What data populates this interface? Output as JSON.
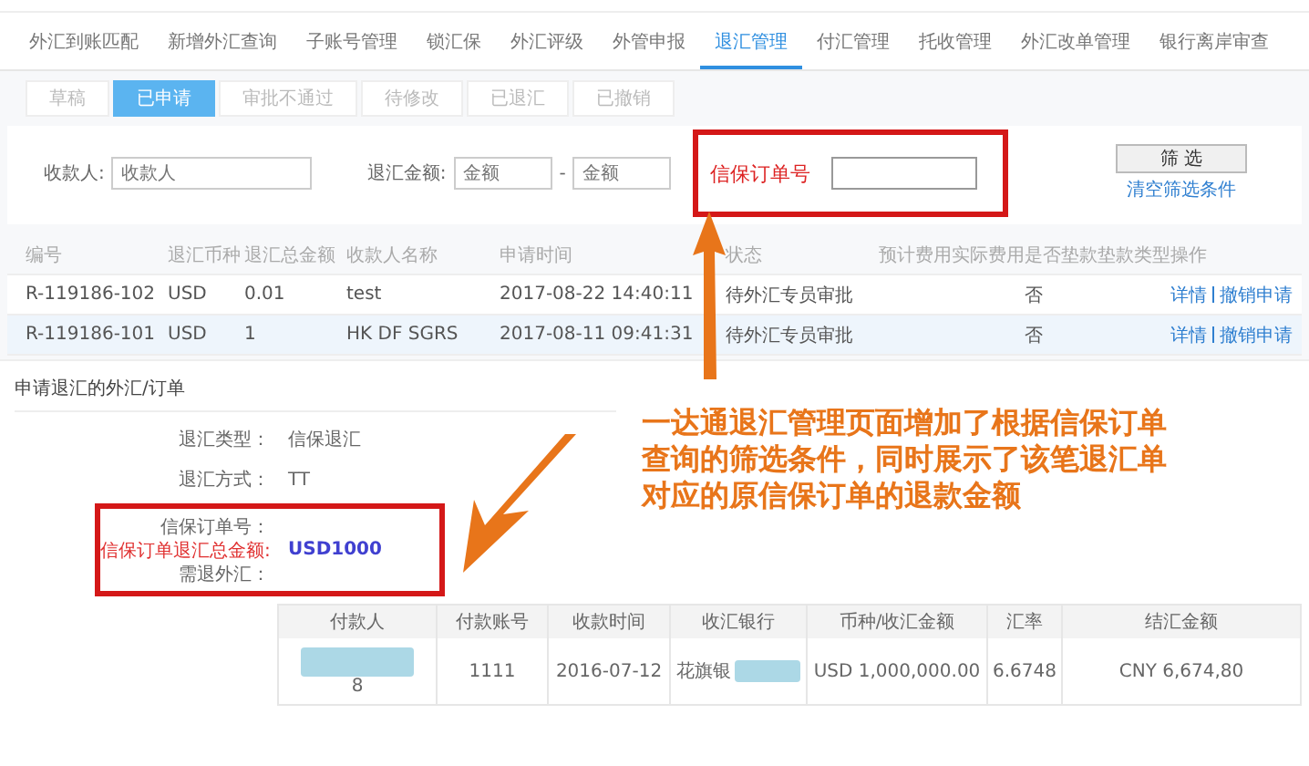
{
  "nav_tabs": [
    {
      "label": "外汇到账匹配",
      "selected": false
    },
    {
      "label": "新增外汇查询",
      "selected": false
    },
    {
      "label": "子账号管理",
      "selected": false
    },
    {
      "label": "锁汇保",
      "selected": false
    },
    {
      "label": "外汇评级",
      "selected": false
    },
    {
      "label": "外管申报",
      "selected": false
    },
    {
      "label": "退汇管理",
      "selected": true
    },
    {
      "label": "付汇管理",
      "selected": false
    },
    {
      "label": "托收管理",
      "selected": false
    },
    {
      "label": "外汇改单管理",
      "selected": false
    },
    {
      "label": "银行离岸审查",
      "selected": false
    }
  ],
  "status_tabs": [
    {
      "label": "草稿",
      "selected": false
    },
    {
      "label": "已申请",
      "selected": true
    },
    {
      "label": "审批不通过",
      "selected": false
    },
    {
      "label": "待修改",
      "selected": false
    },
    {
      "label": "已退汇",
      "selected": false
    },
    {
      "label": "已撤销",
      "selected": false
    }
  ],
  "filters": {
    "payee_label": "收款人:",
    "payee_placeholder": "收款人",
    "amount_label": "退汇金额:",
    "amount_min_placeholder": "金额",
    "separator": "-",
    "amount_max_placeholder": "金额",
    "order_label": "信保订单号",
    "filter_button": "筛 选",
    "clear_link": "清空筛选条件"
  },
  "table": {
    "columns": [
      "编号",
      "退汇币种",
      "退汇总金额",
      "收款人名称",
      "申请时间",
      "状态",
      "预计费用",
      "实际费用",
      "是否垫款",
      "垫款类型",
      "操作"
    ],
    "rows": [
      {
        "cells": [
          "R-119186-102",
          "USD",
          "0.01",
          "test",
          "2017-08-22 14:40:11",
          "待外汇专员审批",
          "",
          "",
          "否",
          ""
        ],
        "actions": [
          "详情",
          "撤销申请"
        ],
        "selected": false
      },
      {
        "cells": [
          "R-119186-101",
          "USD",
          "1",
          "HK DF SGRS",
          "2017-08-11 09:41:31",
          "待外汇专员审批",
          "",
          "",
          "否",
          ""
        ],
        "actions": [
          "详情",
          "撤销申请"
        ],
        "selected": true
      }
    ]
  },
  "annotation": "一达通退汇管理页面增加了根据信保订单查询的筛选条件，同时展示了该笔退汇单对应的原信保订单的退款金额",
  "detail": {
    "title": "申请退汇的外汇/订单",
    "fields": [
      {
        "label": "退汇类型：",
        "value": "信保退汇",
        "kind": "plain"
      },
      {
        "label": "退汇方式：",
        "value": "TT",
        "kind": "plain"
      },
      {
        "label": "信保订单号：",
        "kind": "plain"
      },
      {
        "label": "信保订单退汇总金额:",
        "value": "USD1000",
        "kind": "highlight"
      },
      {
        "label": "需退外汇：",
        "kind": "plain"
      }
    ],
    "table": {
      "columns": [
        "付款人",
        "付款账号",
        "收款时间",
        "收汇银行",
        "币种/收汇金额",
        "汇率",
        "结汇金额"
      ],
      "rows": [
        {
          "cells": [
            "8",
            "1111",
            "2016-07-12",
            "花旗银",
            "USD 1,000,000.00",
            "6.6748",
            "CNY 6,674,80"
          ]
        }
      ]
    }
  }
}
